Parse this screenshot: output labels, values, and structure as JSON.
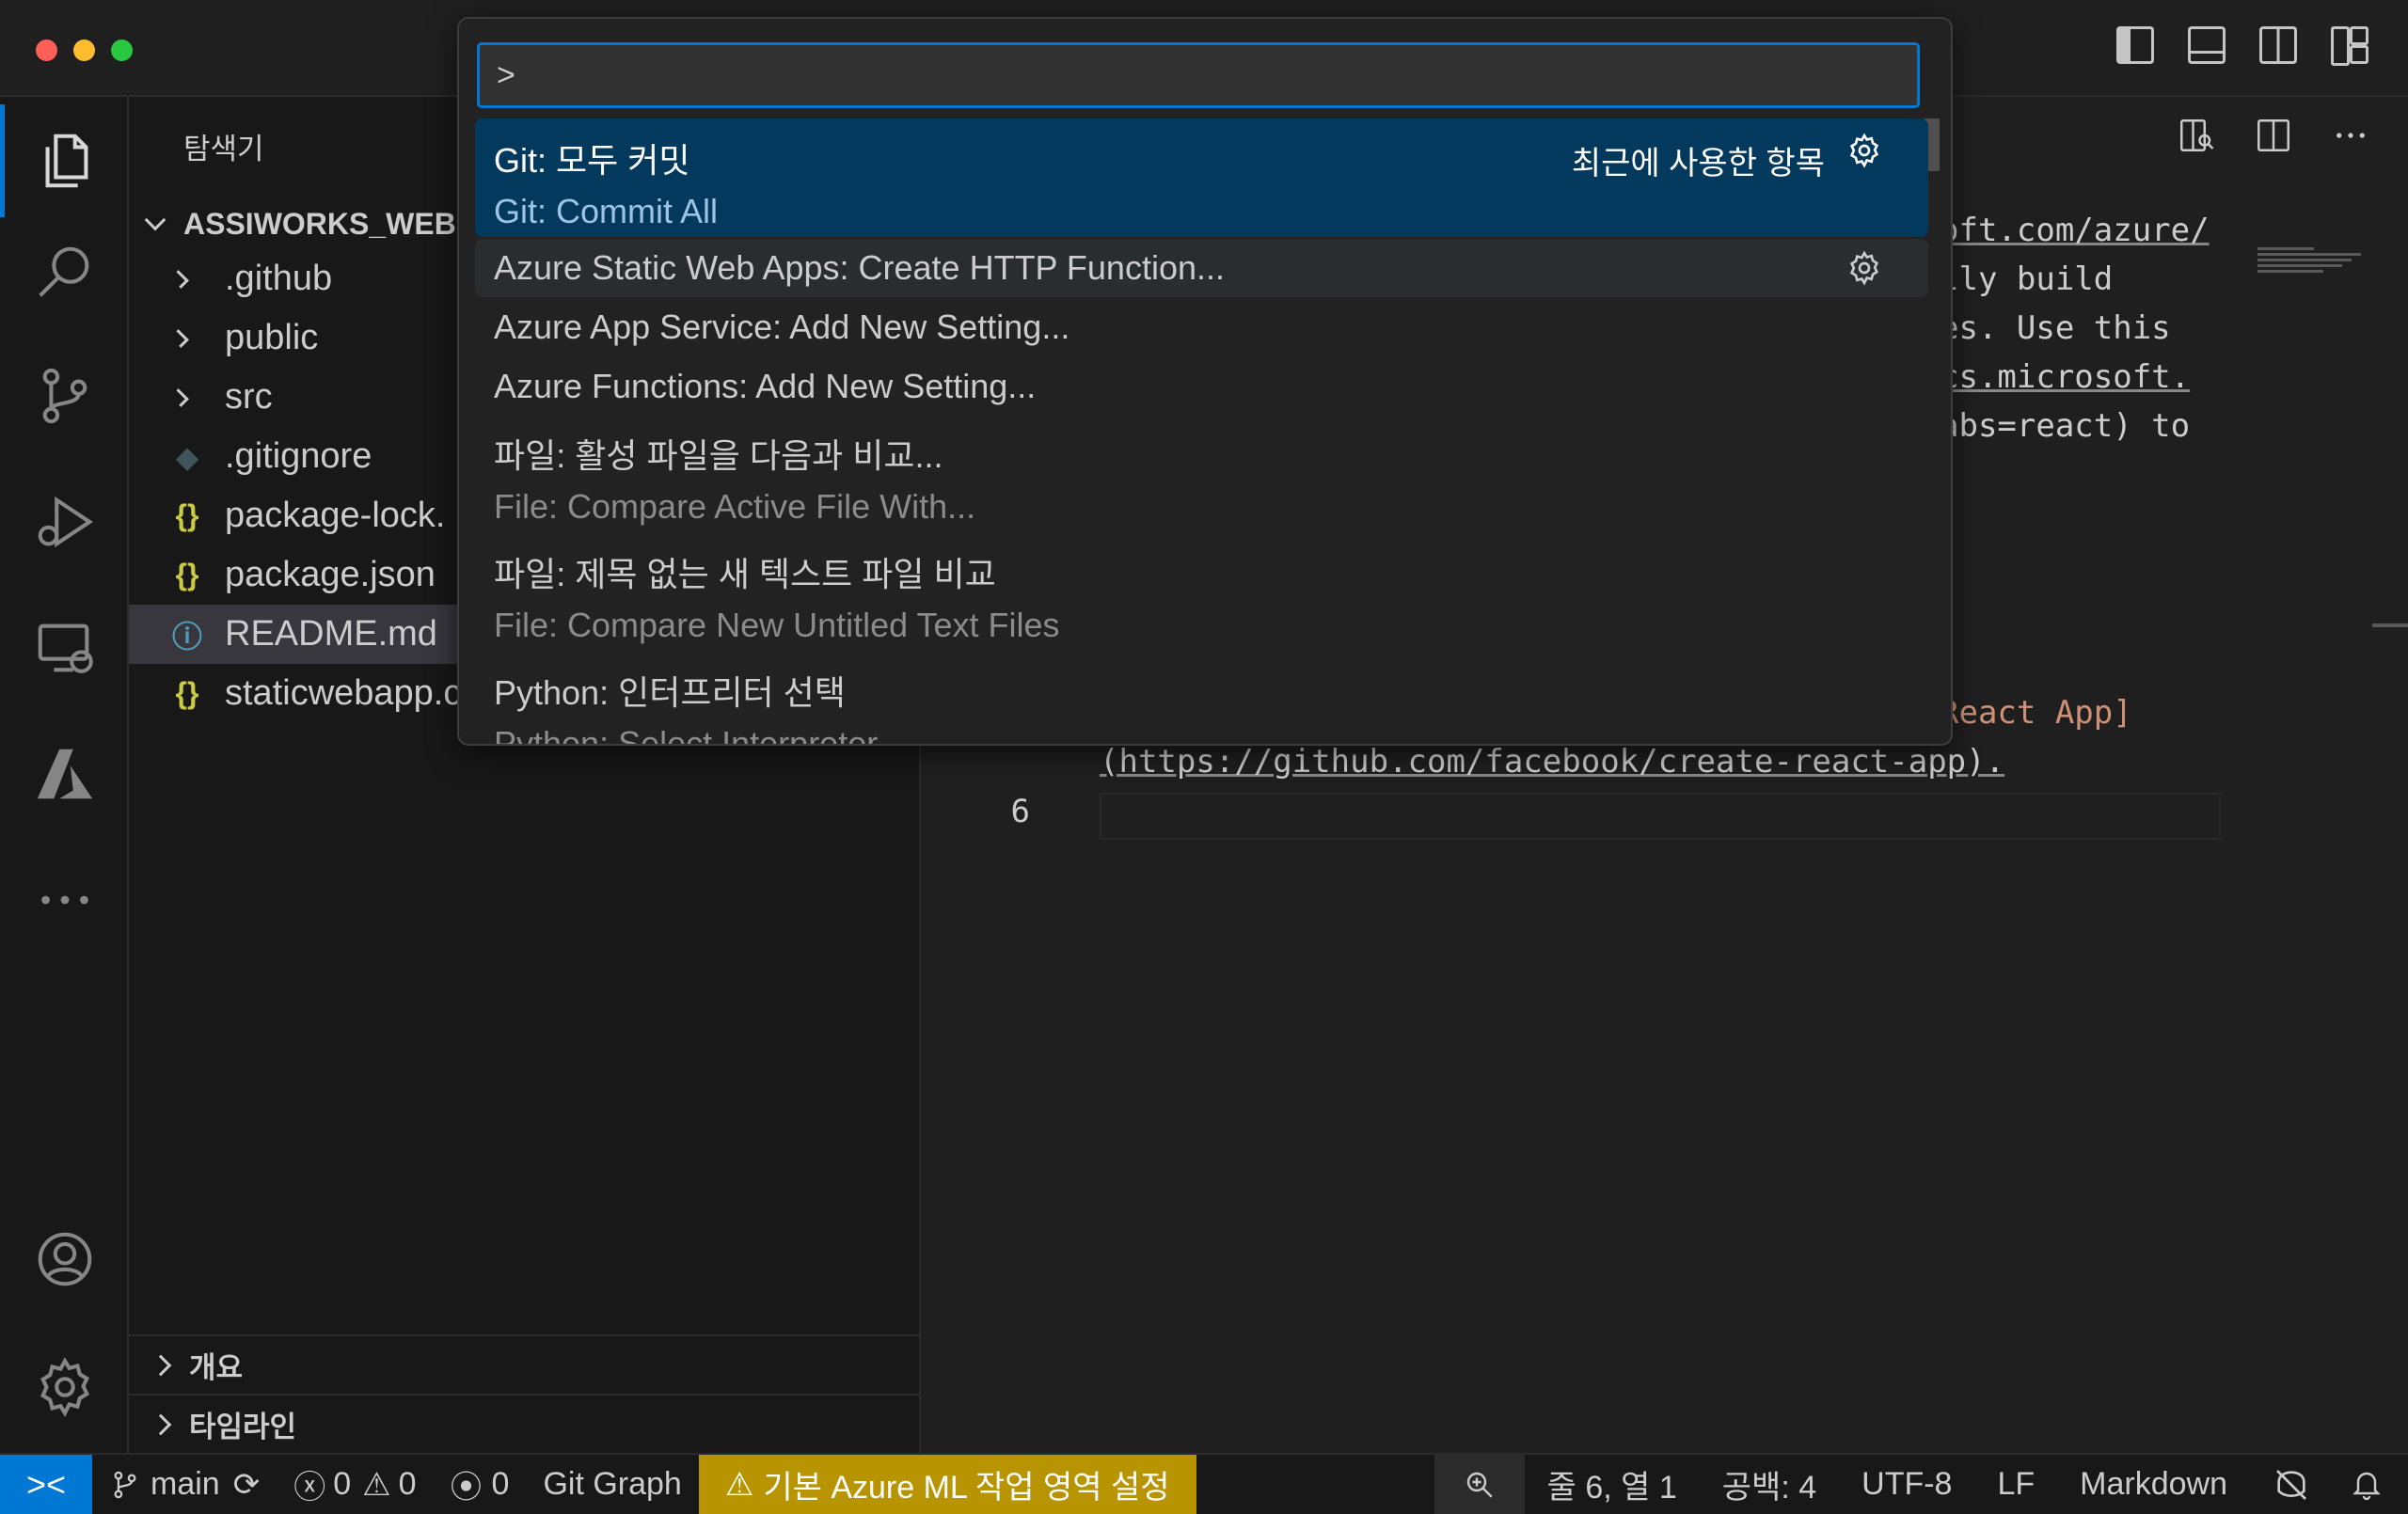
{
  "sidebar": {
    "title": "탐색기",
    "root": "ASSIWORKS_WEB",
    "items": [
      {
        "label": ".github",
        "type": "folder"
      },
      {
        "label": "public",
        "type": "folder"
      },
      {
        "label": "src",
        "type": "folder"
      },
      {
        "label": ".gitignore",
        "type": "git"
      },
      {
        "label": "package-lock.",
        "type": "json"
      },
      {
        "label": "package.json",
        "type": "json"
      },
      {
        "label": "README.md",
        "type": "info"
      },
      {
        "label": "staticwebapp.c",
        "type": "json"
      }
    ],
    "outline": "개요",
    "timeline": "타임라인"
  },
  "palette": {
    "input_value": ">",
    "recent_label": "최근에 사용한 항목",
    "items": [
      {
        "label": "Git: 모두 커밋",
        "detail": "Git: Commit All"
      },
      {
        "label": "Azure Static Web Apps: Create HTTP Function..."
      },
      {
        "label": "Azure App Service: Add New Setting..."
      },
      {
        "label": "Azure Functions: Add New Setting..."
      },
      {
        "label": "파일: 활성 파일을 다음과 비교...",
        "detail": "File: Compare Active File With..."
      },
      {
        "label": "파일: 제목 없는 새 텍스트 파일 비교",
        "detail": "File: Compare New Untitled Text Files"
      },
      {
        "label": "Python: 인터프리터 선택",
        "detail": "Python: Select Interpreter"
      }
    ]
  },
  "editor": {
    "lines": [
      "oft.com/azure/",
      "lly build",
      "es. Use this",
      "cs.microsoft.",
      "abs=react) to",
      "React App]",
      "(https://github.com/facebook/create-react-app)."
    ],
    "line_number": "6"
  },
  "statusbar": {
    "remote": "><",
    "branch": "main",
    "errors": "0",
    "warnings": "0",
    "ports": "0",
    "git_graph": "Git Graph",
    "warning_label": "기본 Azure ML 작업 영역 설정",
    "position": "줄 6, 열 1",
    "spaces": "공백: 4",
    "encoding": "UTF-8",
    "eol": "LF",
    "language": "Markdown"
  },
  "colors": {
    "accent": "#0078d4",
    "warning_bg": "#b89500",
    "focused_item": "#04395e"
  }
}
